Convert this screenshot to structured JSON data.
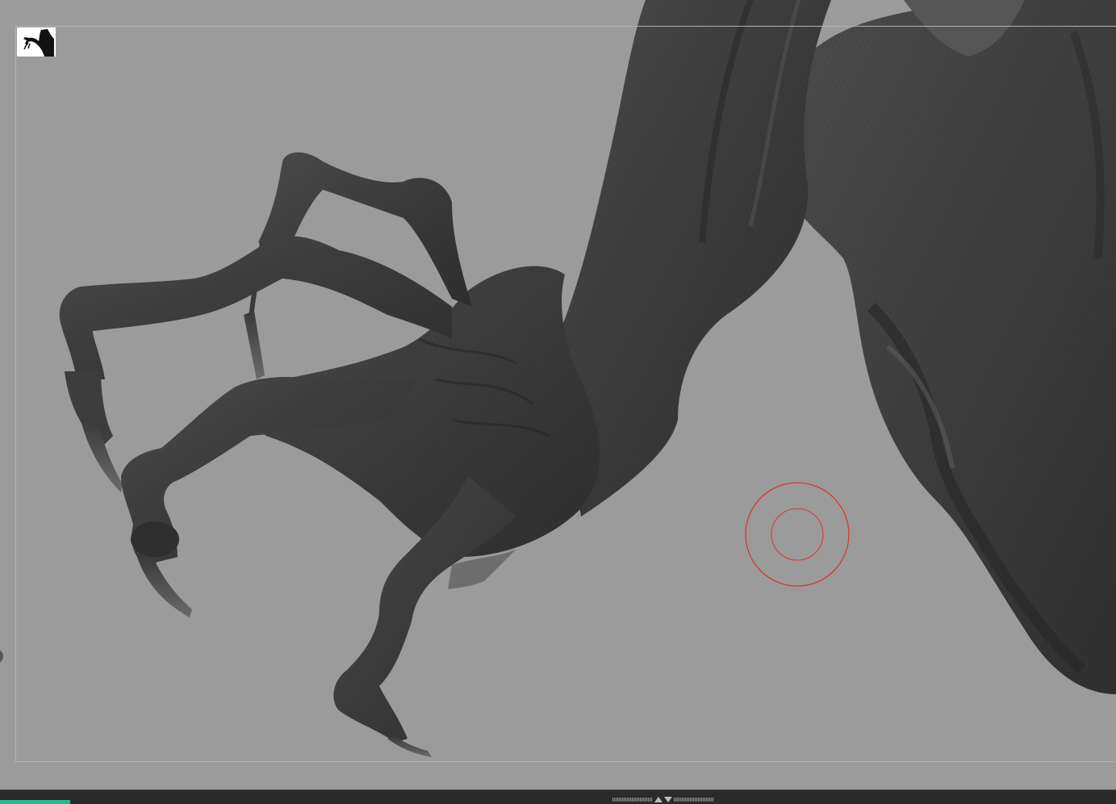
{
  "viewport": {
    "background": "#9b9b9b",
    "model_tone": "#3e3e3e",
    "brush_color": "#d63a32"
  },
  "icons": {
    "document_thumbnail": "creature-silhouette-icon",
    "tray_toggle": "expand-collapse-arrows-icon",
    "side_handle": "side-tray-handle-icon"
  },
  "tray": {
    "accent": "#1fbd8d",
    "progress_fraction": 0.0629
  }
}
